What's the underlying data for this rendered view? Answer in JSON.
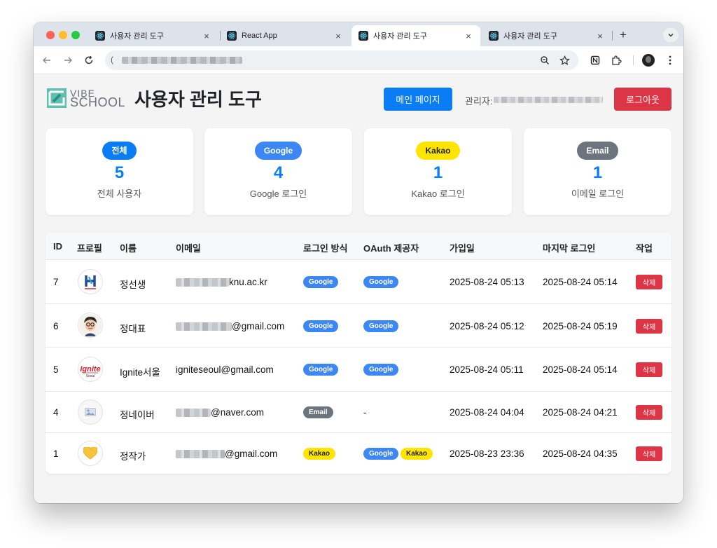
{
  "browser": {
    "tabs": [
      {
        "title": "사용자 관리 도구",
        "active": false
      },
      {
        "title": "React App",
        "active": false
      },
      {
        "title": "사용자 관리 도구",
        "active": true
      },
      {
        "title": "사용자 관리 도구",
        "active": false
      }
    ],
    "close_glyph": "×",
    "new_tab_glyph": "+",
    "icons": [
      "back-icon",
      "forward-icon",
      "reload-icon",
      "zoom-icon",
      "bookmark-star-icon",
      "notion-extension-icon",
      "extensions-puzzle-icon",
      "profile-avatar-icon",
      "menu-kebab-icon"
    ]
  },
  "header": {
    "logo_line1": "VIBE",
    "logo_line2": "SCHOOL",
    "title": "사용자 관리 도구",
    "main_button": "메인 페이지",
    "admin_label": "관리자:",
    "logout_button": "로그아웃"
  },
  "stats": [
    {
      "badge": "전체",
      "count": "5",
      "label": "전체 사용자",
      "color": "#0a7cf4"
    },
    {
      "badge": "Google",
      "count": "4",
      "label": "Google 로그인",
      "color": "#3d87f5"
    },
    {
      "badge": "Kakao",
      "count": "1",
      "label": "Kakao 로그인",
      "color": "#fee500"
    },
    {
      "badge": "Email",
      "count": "1",
      "label": "이메일 로그인",
      "color": "#6c757d"
    }
  ],
  "table": {
    "headers": [
      "ID",
      "프로필",
      "이름",
      "이메일",
      "로그인 방식",
      "OAuth 제공자",
      "가입일",
      "마지막 로그인",
      "작업"
    ],
    "delete_label": "삭제",
    "rows": [
      {
        "id": "7",
        "name": "정선생",
        "email_domain": "knu.ac.kr",
        "login": "Google",
        "providers": [
          "Google"
        ],
        "joined": "2025-08-24 05:13",
        "last": "2025-08-24 05:14"
      },
      {
        "id": "6",
        "name": "정대표",
        "email_domain": "@gmail.com",
        "login": "Google",
        "providers": [
          "Google"
        ],
        "joined": "2025-08-24 05:12",
        "last": "2025-08-24 05:19"
      },
      {
        "id": "5",
        "name": "Ignite서울",
        "email": "igniteseoul@gmail.com",
        "login": "Google",
        "providers": [
          "Google"
        ],
        "joined": "2025-08-24 05:11",
        "last": "2025-08-24 05:14"
      },
      {
        "id": "4",
        "name": "정네이버",
        "email_domain": "@naver.com",
        "login": "Email",
        "providers_text": "-",
        "joined": "2025-08-24 04:04",
        "last": "2025-08-24 04:21"
      },
      {
        "id": "1",
        "name": "정작가",
        "email_domain": "@gmail.com",
        "login": "Kakao",
        "providers": [
          "Google",
          "Kakao"
        ],
        "joined": "2025-08-23 23:36",
        "last": "2025-08-24 04:35"
      }
    ]
  },
  "colors": {
    "primary": "#0a7cf4",
    "danger": "#dc3545",
    "google": "#3d87f5",
    "kakao": "#fee500",
    "email": "#6c757d"
  }
}
